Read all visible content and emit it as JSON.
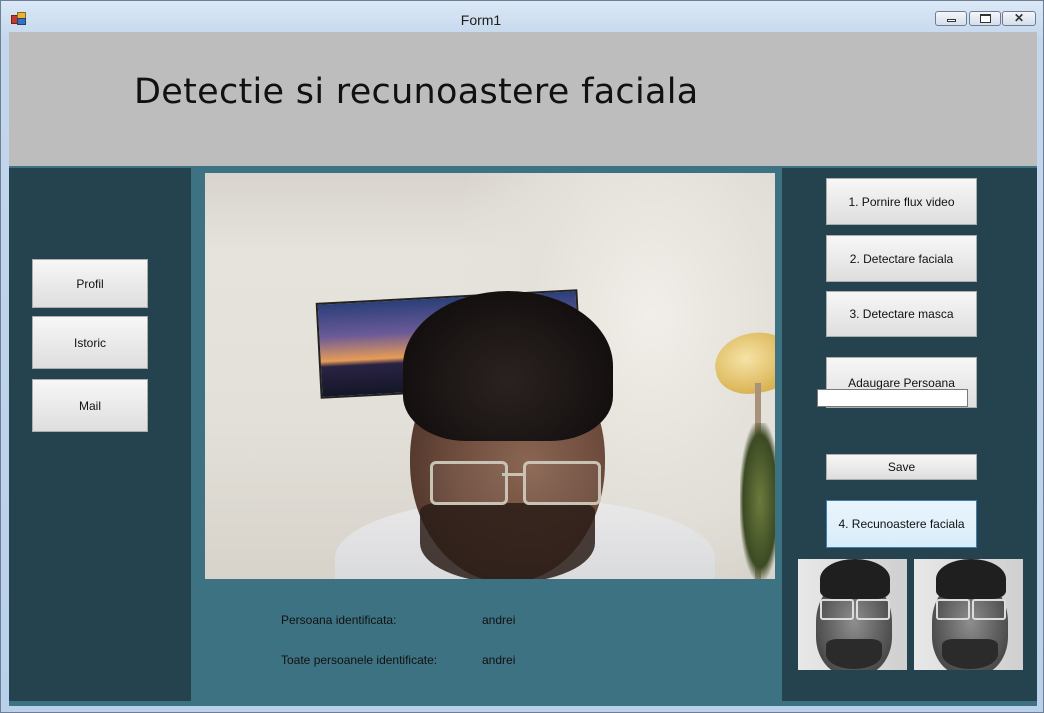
{
  "window": {
    "title": "Form1"
  },
  "header": {
    "title": "Detectie si recunoastere faciala"
  },
  "left_nav": {
    "profil": "Profil",
    "istoric": "Istoric",
    "mail": "Mail"
  },
  "actions": {
    "start_video": "1. Pornire flux video",
    "face_detection": "2. Detectare faciala",
    "mask_detection": "3. Detectare masca",
    "add_person": "Adaugare Persoana",
    "name_input_value": "",
    "save": "Save",
    "face_recognition": "4. Recunoastere faciala"
  },
  "results": {
    "identified_label": "Persoana identificata:",
    "identified_value": "andrei",
    "all_identified_label": "Toate persoanele identificate:",
    "all_identified_value": "andrei"
  },
  "colors": {
    "header_bg": "#bdbdbd",
    "panel_dark": "#24434e",
    "center_bg": "#3d7282"
  },
  "icons": {
    "app": "winforms-app-icon",
    "minimize": "minimize-icon",
    "maximize": "maximize-icon",
    "close": "close-icon"
  }
}
